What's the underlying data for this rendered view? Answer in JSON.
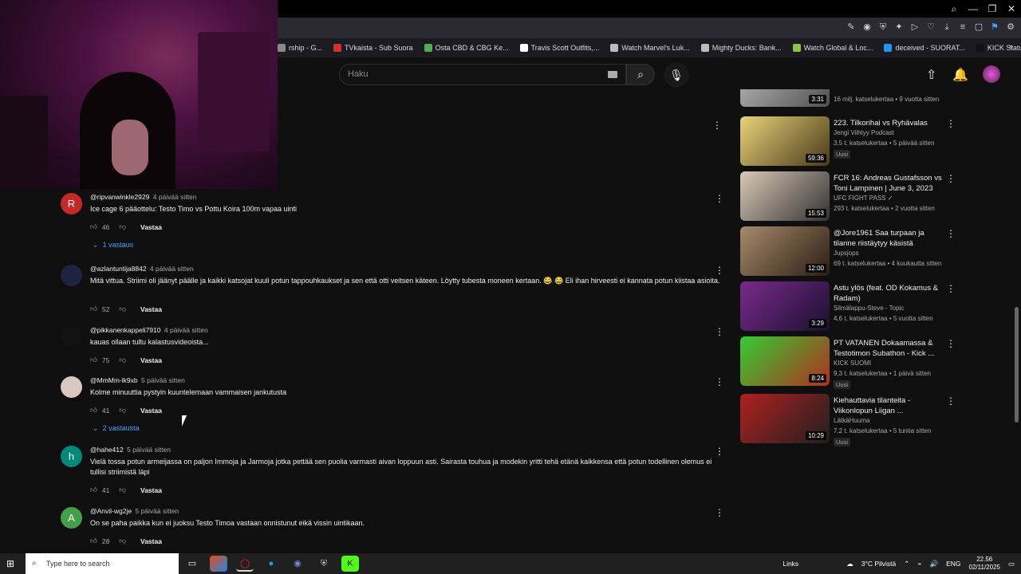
{
  "window": {
    "min": "—",
    "max": "❐",
    "close": "✕",
    "search": "⌕"
  },
  "bookmarks": [
    {
      "label": "rship - G...",
      "color": "#888"
    },
    {
      "label": "TVkaista - Sub Suora",
      "color": "#d32f2f"
    },
    {
      "label": "Osta CBD & CBG Ke...",
      "color": "#4caf50"
    },
    {
      "label": "Travis Scott Outfits,...",
      "color": "#ffffff"
    },
    {
      "label": "Watch Marvel's Luk...",
      "color": "#bbbbbb"
    },
    {
      "label": "Mighty Ducks: Bank...",
      "color": "#bbbbbb"
    },
    {
      "label": "Watch Global & Loc...",
      "color": "#8bc34a"
    },
    {
      "label": "deceived - SUORAT...",
      "color": "#2196f3"
    },
    {
      "label": "KICK Status Page",
      "color": "#111111"
    }
  ],
  "youtube": {
    "search_placeholder": "Haku"
  },
  "comments": [
    {
      "avatar_letter": "R",
      "avatar_color": "#c62828",
      "user": "@ripvanwinkle2929",
      "time": "4 päivää sitten",
      "text": "Ice cage 6 pääottelu: Testo Timo vs Pottu Koira 100m vapaa uinti",
      "likes": "46",
      "reply_label": "Vastaa",
      "replies": "1 vastaus"
    },
    {
      "avatar_letter": "",
      "avatar_color": "#1e2440",
      "user": "@azlantuntija8842",
      "time": "4 päivää sitten",
      "text": "Mitä vittua. Striimi oli jäänyt päälle ja kaikki katsojat kuuli potun tappouhkaukset ja sen että otti veitsen käteen. Löytty tubesta moneen kertaan. 😂 😂 Eli ihan hirveesti ei kannata potun kiistaa asioita.",
      "likes": "52",
      "reply_label": "Vastaa"
    },
    {
      "avatar_letter": "",
      "avatar_color": "#121212",
      "user": "@pikkanenkappeli7910",
      "time": "4 päivää sitten",
      "text": "kauas ollaan tultu kalastusvideoista...",
      "likes": "75",
      "reply_label": "Vastaa"
    },
    {
      "avatar_letter": "",
      "avatar_color": "#d8c8c0",
      "user": "@MmMm-lk9xb",
      "time": "5 päivää sitten",
      "text": "Kolme minuuttia pystyin kuuntelemaan vammaisen jankutusta",
      "likes": "41",
      "reply_label": "Vastaa",
      "replies": "2 vastausta"
    },
    {
      "avatar_letter": "h",
      "avatar_color": "#00897b",
      "user": "@hahe412",
      "time": "5 päivää sitten",
      "text": "Vielä tossa potun armeijassa on paljon Immoja ja Jarmoja jotka pettää sen puolia varmasti aivan loppuun asti. Sairasta touhua ja modekin yritti tehä etänä kaikkensa että potun todellinen olemus ei tullisi striimistä läpi",
      "likes": "41",
      "reply_label": "Vastaa"
    },
    {
      "avatar_letter": "A",
      "avatar_color": "#43a047",
      "user": "@Anvil-wg2je",
      "time": "5 päivää sitten",
      "text": "On se paha paikka kun ei juoksu Testo Timoa vastaan onnistunut eikä vissin uintikaan.",
      "likes": "28",
      "reply_label": "Vastaa"
    }
  ],
  "videos": [
    {
      "title": "...",
      "channel": "",
      "meta": "16 milj. katselukertaa • 9 vuotta sitten",
      "duration": "3:31",
      "badge": "",
      "c1": "#c0c0c0",
      "c2": "#505050"
    },
    {
      "title": "223. Tilkorihai vs Ryhävalas",
      "channel": "Jengi Viihtyy Podcast",
      "meta": "3,5 t. katselukertaa • 5 päivää sitten",
      "duration": "59:36",
      "badge": "Uusi",
      "c1": "#e8d27a",
      "c2": "#4a3a1a"
    },
    {
      "title": "FCR 16: Andreas Gustafsson vs Toni Lampinen | June 3, 2023",
      "channel": "UFC FIGHT PASS ✓",
      "meta": "293 t. katselukertaa • 2 vuotta sitten",
      "duration": "15:53",
      "badge": "",
      "c1": "#d9c8b6",
      "c2": "#333333"
    },
    {
      "title": "@Jore1961 Saa turpaan ja tilanne riistäytyy käsistä",
      "channel": "Jupsjops",
      "meta": "69 t. katselukertaa • 4 kuukautta sitten",
      "duration": "12:00",
      "badge": "",
      "c1": "#a88a6a",
      "c2": "#2a1e14"
    },
    {
      "title": "Astu ylös (feat. OD Kokamus & Radam)",
      "channel": "Silmälappu-Steve - Topic",
      "meta": "4,6 t. katselukertaa • 5 vuotta sitten",
      "duration": "3:29",
      "badge": "",
      "c1": "#7a2a8a",
      "c2": "#1a1030"
    },
    {
      "title": "PT VATANEN Dokaamassa & Testotimon Subathon - Kick ...",
      "channel": "KICK SUOMI",
      "meta": "9,3 t. katselukertaa • 1 päivä sitten",
      "duration": "8:24",
      "badge": "Uusi",
      "c1": "#33cc33",
      "c2": "#b03020"
    },
    {
      "title": "Kiehauttavia tilanteita - Viikonlopun Liigan ...",
      "channel": "LätkäHuuma",
      "meta": "7,2 t. katselukertaa • 5 tuntia sitten",
      "duration": "10:29",
      "badge": "Uusi",
      "c1": "#b02020",
      "c2": "#202020"
    }
  ],
  "taskbar": {
    "search_placeholder": "Type here to search",
    "links": "Links",
    "weather": "3°C Pilvistä",
    "lang": "ENG",
    "time": "22.56",
    "date": "02/11/2025"
  }
}
